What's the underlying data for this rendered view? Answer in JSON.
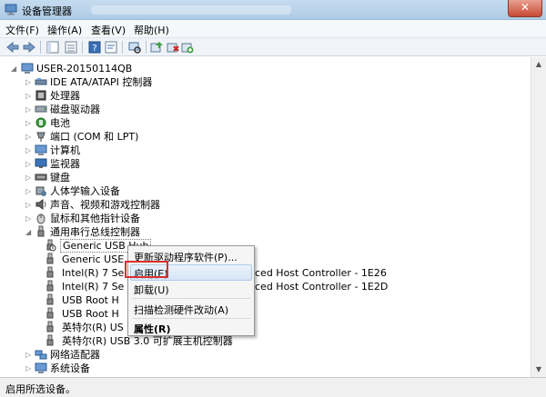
{
  "window": {
    "title": "设备管理器",
    "close_label": "✕"
  },
  "menu": [
    "文件(F)",
    "操作(A)",
    "查看(V)",
    "帮助(H)"
  ],
  "tree": {
    "root": "USER-20150114QB",
    "categories": [
      "IDE ATA/ATAPI 控制器",
      "处理器",
      "磁盘驱动器",
      "电池",
      "端口 (COM 和 LPT)",
      "计算机",
      "监视器",
      "键盘",
      "人体学输入设备",
      "声音、视频和游戏控制器",
      "鼠标和其他指针设备",
      "通用串行总线控制器"
    ],
    "usb_children": [
      "Generic USB Hub",
      "Generic USE",
      "Intel(R) 7 Se",
      "Intel(R) 7 Se",
      "USB Root H",
      "USB Root H",
      "英特尔(R) US",
      "英特尔(R) USB 3.0 可扩展主机控制器"
    ],
    "usb_tail_1": "ced Host Controller - 1E26",
    "usb_tail_2": "ced Host Controller - 1E2D",
    "after": [
      "网络适配器",
      "系统设备"
    ]
  },
  "context_menu": {
    "update": "更新驱动程序软件(P)...",
    "enable": "启用(E)",
    "uninstall": "卸载(U)",
    "scan": "扫描检测硬件改动(A)",
    "properties": "属性(R)"
  },
  "status": "启用所选设备。",
  "colors": {
    "highlight_border": "#d93030",
    "titlebar": "#c5dbef"
  }
}
